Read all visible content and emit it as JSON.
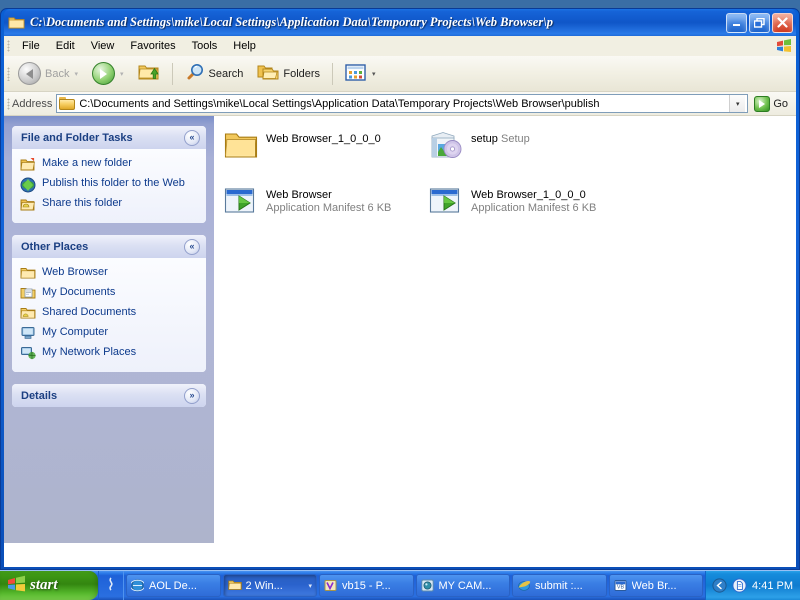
{
  "window": {
    "title": "C:\\Documents and Settings\\mike\\Local Settings\\Application Data\\Temporary Projects\\Web Browser\\p",
    "title_icon": "folder-icon",
    "controls": {
      "minimize": "_",
      "maximize": "❐",
      "close": "✕"
    }
  },
  "menubar": {
    "items": [
      {
        "label": "File"
      },
      {
        "label": "Edit"
      },
      {
        "label": "View"
      },
      {
        "label": "Favorites"
      },
      {
        "label": "Tools"
      },
      {
        "label": "Help"
      }
    ],
    "flag_icon": "windows-flag-icon"
  },
  "toolbar": {
    "back": {
      "label": "Back",
      "icon": "arrow-left-icon",
      "disabled": true,
      "caret": "▾"
    },
    "forward": {
      "label": "",
      "icon": "arrow-right-icon",
      "disabled": false,
      "caret": "▾"
    },
    "up": {
      "label": "",
      "icon": "folder-up-icon"
    },
    "search": {
      "label": "Search",
      "icon": "magnifier-icon"
    },
    "folders": {
      "label": "Folders",
      "icon": "folders-icon"
    },
    "views": {
      "label": "",
      "icon": "views-grid-icon",
      "caret": "▾"
    }
  },
  "addressbar": {
    "label": "Address",
    "icon": "folder-icon",
    "value": "C:\\Documents and Settings\\mike\\Local Settings\\Application Data\\Temporary Projects\\Web Browser\\publish",
    "placeholder": "Address",
    "dropdown_caret": "▾",
    "go_label": "Go",
    "go_icon": "green-arrow-icon"
  },
  "sidebar": {
    "panels": [
      {
        "title": "File and Folder Tasks",
        "chevron": "«",
        "collapsed": false,
        "items": [
          {
            "label": "Make a new folder",
            "icon": "new-folder-icon"
          },
          {
            "label": "Publish this folder to the Web",
            "icon": "publish-web-icon"
          },
          {
            "label": "Share this folder",
            "icon": "share-folder-icon"
          }
        ]
      },
      {
        "title": "Other Places",
        "chevron": "«",
        "collapsed": false,
        "items": [
          {
            "label": "Web Browser",
            "icon": "folder-icon"
          },
          {
            "label": "My Documents",
            "icon": "my-documents-icon"
          },
          {
            "label": "Shared Documents",
            "icon": "shared-documents-icon"
          },
          {
            "label": "My Computer",
            "icon": "my-computer-icon"
          },
          {
            "label": "My Network Places",
            "icon": "network-places-icon"
          }
        ]
      },
      {
        "title": "Details",
        "chevron": "»",
        "collapsed": true,
        "items": []
      }
    ]
  },
  "content": {
    "files": [
      {
        "name": "Web Browser_1_0_0_0",
        "type": "",
        "size": "",
        "icon": "folder-large-icon"
      },
      {
        "name": "setup",
        "type": "Setup",
        "size": "",
        "icon": "setup-installer-icon"
      },
      {
        "name": "Web Browser",
        "type": "Application Manifest",
        "size": "6 KB",
        "icon": "application-manifest-icon"
      },
      {
        "name": "Web Browser_1_0_0_0",
        "type": "Application Manifest",
        "size": "6 KB",
        "icon": "application-manifest-icon"
      }
    ]
  },
  "taskbar": {
    "start_label": "start",
    "start_icon": "windows-flag-icon",
    "quicklaunch_icon": "quicklaunch-icon",
    "tasks": [
      {
        "label": "AOL De...",
        "icon": "aol-icon",
        "active": false
      },
      {
        "label": "2 Win...",
        "icon": "folder-icon",
        "active": true,
        "caret": "▾"
      },
      {
        "label": "vb15 - P...",
        "icon": "vb-icon",
        "active": false
      },
      {
        "label": "MY CAM...",
        "icon": "camera-icon",
        "active": false
      },
      {
        "label": "submit :...",
        "icon": "ie-icon",
        "active": false
      },
      {
        "label": "Web Br...",
        "icon": "vb-project-icon",
        "active": false
      }
    ],
    "tray": {
      "show_hidden_icon": "chevron-left-icon",
      "icons": [
        "document-icon"
      ],
      "time": "4:41 PM"
    }
  },
  "colors": {
    "titlebar_blue": "#0f56c8",
    "sidebar_bg": "#aeb4cc",
    "panel_head": "#dbe0f3",
    "link_blue": "#0d3a8c",
    "start_green": "#338610",
    "taskbar_blue": "#1e61d8",
    "close_red": "#cf3a20"
  }
}
